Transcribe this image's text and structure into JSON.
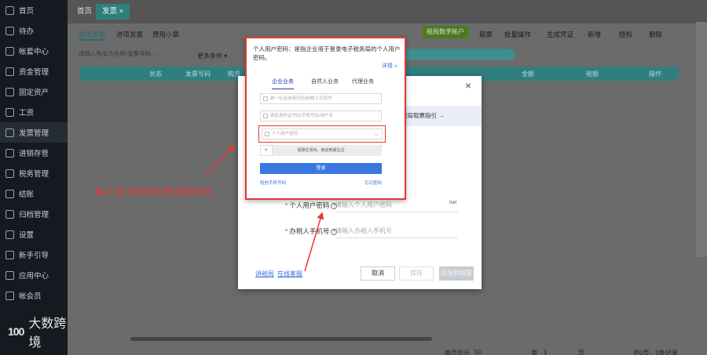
{
  "sidebar": {
    "items": [
      {
        "label": "首页"
      },
      {
        "label": "待办"
      },
      {
        "label": "帐套中心"
      },
      {
        "label": "资金管理"
      },
      {
        "label": "固定资产"
      },
      {
        "label": "工资"
      },
      {
        "label": "发票管理"
      },
      {
        "label": "进销存管"
      },
      {
        "label": "税务管理"
      },
      {
        "label": "结账"
      },
      {
        "label": "归档管理"
      },
      {
        "label": "设置"
      },
      {
        "label": "新手引导"
      },
      {
        "label": "应用中心"
      },
      {
        "label": "帐会员"
      }
    ],
    "logo_mark": "100",
    "logo_text": "大数跨境"
  },
  "main": {
    "tabs": [
      "首页",
      "发票 ×"
    ],
    "subtabs": [
      "销项发票",
      "进项发票",
      "费用小票"
    ],
    "search_placeholder": "请输入购买方名称/发票号码...",
    "more_filter": "更多条件 ▾",
    "actions": [
      "取票",
      "批量操作",
      "生成凭证",
      "新增",
      "授权",
      "删除"
    ],
    "green_button": "税局数字账户",
    "table_headers": [
      "",
      "",
      "状态",
      "发票号码",
      "购方",
      "金额",
      "税额",
      "操作"
    ],
    "pager": {
      "per_page_label": "每页显示",
      "per_page": "50",
      "page_label": "第",
      "page": "1",
      "page_unit": "页",
      "total": "共0页，0条记录"
    }
  },
  "dialog": {
    "banner_text": "税局取票指引 →",
    "pwd_label": "个人用户密码",
    "pwd_placeholder": "请输入个人用户密码",
    "pwd_suffix": "hwl",
    "phone_label": "办税人手机号",
    "phone_placeholder": "请输入办税人手机号",
    "link_tutorial": "讲税局",
    "link_service": "在线客服",
    "cancel": "取消",
    "save": "保存",
    "save_get": "保存并取票"
  },
  "popup": {
    "title": "个人用户密码：是指企业用于登录电子税务局的个人用户密码。",
    "detail": "详情 »",
    "tabs": [
      "企业业务",
      "自然人业务",
      "代理业务"
    ],
    "input_credit_code": "统一社会信用代码/纳税人识别号",
    "input_phone": "居民身份证号码/手机号码/用户名",
    "input_password": "个人用户密码",
    "slider_text": "请按住滑块，拖动到最右边",
    "login": "登录",
    "link_phone_login": "短信手机号码",
    "link_forgot": "忘记密码"
  },
  "annotation": {
    "text": "输入电子税务局登录的密码"
  },
  "colors": {
    "accent_red": "#e53935",
    "teal": "#2f7f7f",
    "link_blue": "#3a6fd8",
    "login_blue": "#3a78e0"
  }
}
